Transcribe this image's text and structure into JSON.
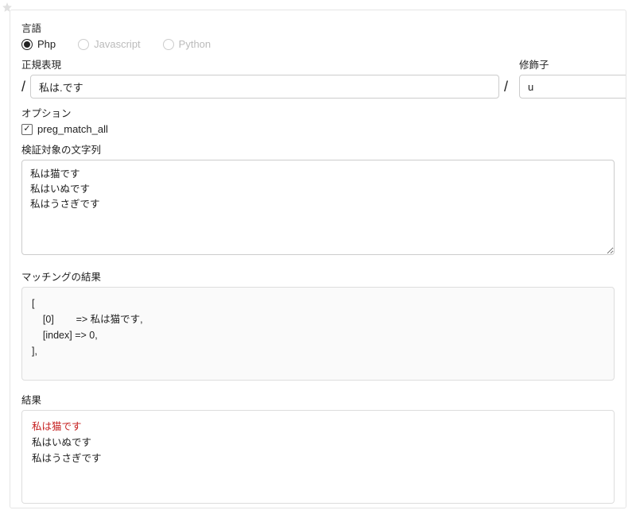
{
  "labels": {
    "language": "言語",
    "regex": "正規表現",
    "modifier": "修飾子",
    "options": "オプション",
    "subject": "検証対象の文字列",
    "match_result": "マッチングの結果",
    "result": "結果"
  },
  "languages": [
    {
      "label": "Php",
      "selected": true
    },
    {
      "label": "Javascript",
      "selected": false
    },
    {
      "label": "Python",
      "selected": false
    }
  ],
  "regex_value": "私は.です",
  "modifier_value": "u",
  "option_checkbox": {
    "label": "preg_match_all",
    "checked": true
  },
  "subject_value": "私は猫です\n私はいぬです\n私はうさぎです",
  "match_result_text": "[\n    [0]        => 私は猫です,\n    [index] => 0,\n],",
  "final_result": {
    "highlighted": "私は猫です",
    "rest": "\n私はいぬです\n私はうさぎです"
  }
}
